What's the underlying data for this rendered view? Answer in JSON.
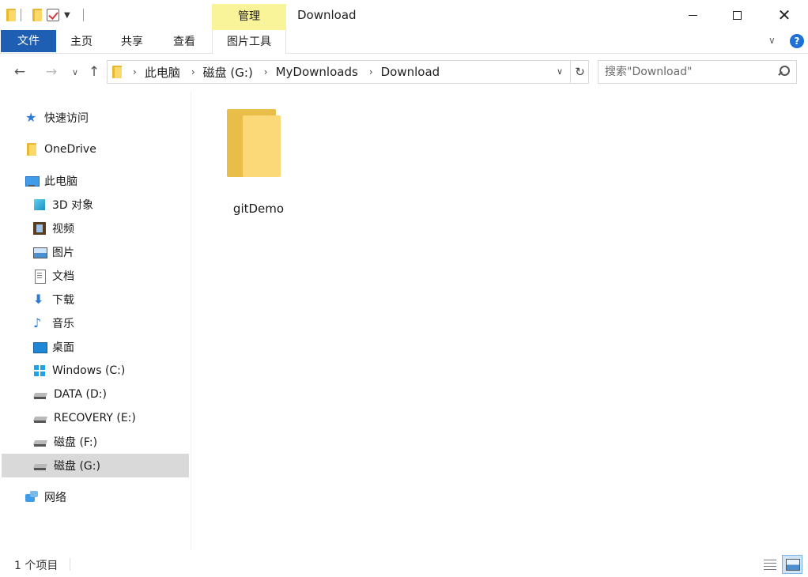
{
  "window": {
    "title": "Download",
    "manage_label": "管理",
    "close_glyph": "✕"
  },
  "ribbon": {
    "tabs": [
      {
        "label": "文件",
        "active": true
      },
      {
        "label": "主页"
      },
      {
        "label": "共享"
      },
      {
        "label": "查看"
      },
      {
        "label": "图片工具"
      }
    ],
    "help_glyph": "?",
    "expand_glyph": "∨"
  },
  "nav": {
    "back_glyph": "←",
    "forward_glyph": "→",
    "recent_glyph": "∨",
    "up_glyph": "↑",
    "refresh_glyph": "↻",
    "breadcrumb": [
      "此电脑",
      "磁盘 (G:)",
      "MyDownloads",
      "Download"
    ],
    "crumb_sep": "›",
    "dropdown_glyph": "∨"
  },
  "search": {
    "placeholder": "搜索\"Download\""
  },
  "sidebar": {
    "items": [
      {
        "label": "快速访问",
        "icon": "star-icon"
      },
      {
        "label": "OneDrive",
        "icon": "folder-icon"
      },
      {
        "label": "此电脑",
        "icon": "computer-icon"
      },
      {
        "label": "3D 对象",
        "icon": "cube-icon"
      },
      {
        "label": "视频",
        "icon": "video-icon"
      },
      {
        "label": "图片",
        "icon": "picture-icon"
      },
      {
        "label": "文档",
        "icon": "document-icon"
      },
      {
        "label": "下载",
        "icon": "download-icon"
      },
      {
        "label": "音乐",
        "icon": "music-icon"
      },
      {
        "label": "桌面",
        "icon": "desktop-icon"
      },
      {
        "label": "Windows (C:)",
        "icon": "windows-drive-icon"
      },
      {
        "label": "DATA (D:)",
        "icon": "drive-icon"
      },
      {
        "label": "RECOVERY (E:)",
        "icon": "drive-icon"
      },
      {
        "label": "磁盘 (F:)",
        "icon": "drive-icon"
      },
      {
        "label": "磁盘 (G:)",
        "icon": "drive-icon",
        "selected": true
      },
      {
        "label": "网络",
        "icon": "network-icon"
      }
    ],
    "star_glyph": "★",
    "down_glyph": "⬇",
    "music_glyph": "♪"
  },
  "content": {
    "files": [
      {
        "name": "gitDemo",
        "type": "folder"
      }
    ]
  },
  "status": {
    "item_count": "1 个项目"
  },
  "colors": {
    "file_tab": "#1e5fb3",
    "manage_tab": "#f9f39a",
    "selected_row": "#d9d9d9",
    "folder_yellow": "#fcd978"
  }
}
